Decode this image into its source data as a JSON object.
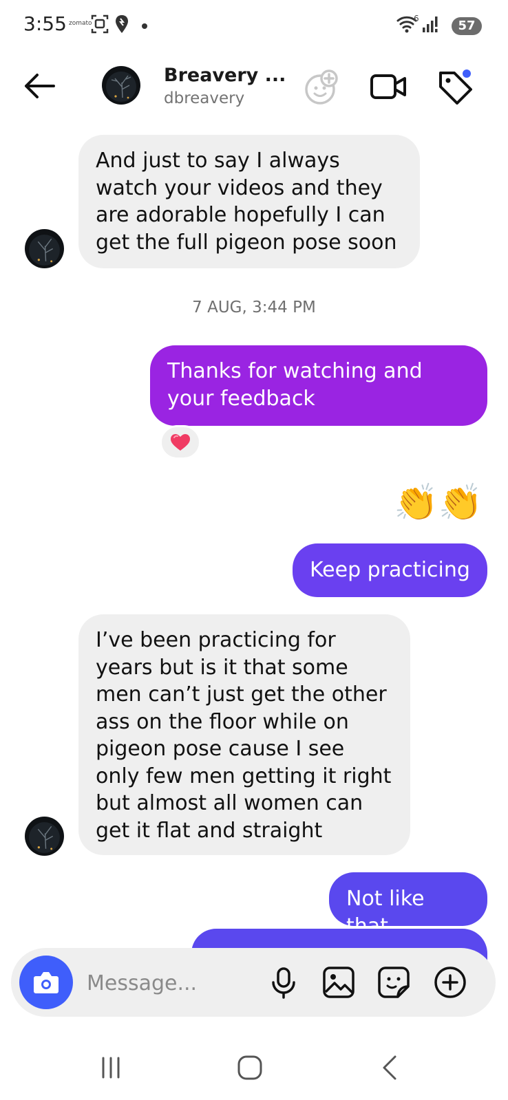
{
  "status_bar": {
    "time": "3:55",
    "app_label": "zomato",
    "network_badge": "6",
    "battery": "57"
  },
  "header": {
    "name": "Breavery ...",
    "username": "dbreavery"
  },
  "messages": [
    {
      "from": "them",
      "text": "And just to say I always watch your videos and they are adorable hopefully I can get the full pigeon pose soon"
    },
    {
      "timestamp": "7 AUG, 3:44 PM"
    },
    {
      "from": "me",
      "text": "Thanks for watching and your feedback",
      "reaction": "❤️"
    },
    {
      "from": "me",
      "text": "👏👏"
    },
    {
      "from": "me",
      "text": "Keep practicing"
    },
    {
      "from": "them",
      "text": "I’ve been practicing for years but is it that some men can’t just get the other ass on the floor while on pigeon pose cause I see only few men getting it right but almost all women can get it flat and straight"
    },
    {
      "from": "me",
      "text": "Not like that"
    }
  ],
  "composer": {
    "placeholder": "Message..."
  },
  "colors": {
    "incoming_bubble": "#efefef",
    "outgoing_purple": "#9a24e2",
    "outgoing_violet": "#6a40f0",
    "outgoing_blue": "#5a48ee",
    "camera_button": "#3f5efb",
    "notification_dot": "#3f5efb"
  },
  "icons": [
    "back-arrow-icon",
    "add-effect-icon",
    "video-call-icon",
    "tag-icon",
    "camera-icon",
    "microphone-icon",
    "gallery-icon",
    "sticker-icon",
    "plus-icon",
    "recents-icon",
    "home-icon",
    "nav-back-icon"
  ]
}
